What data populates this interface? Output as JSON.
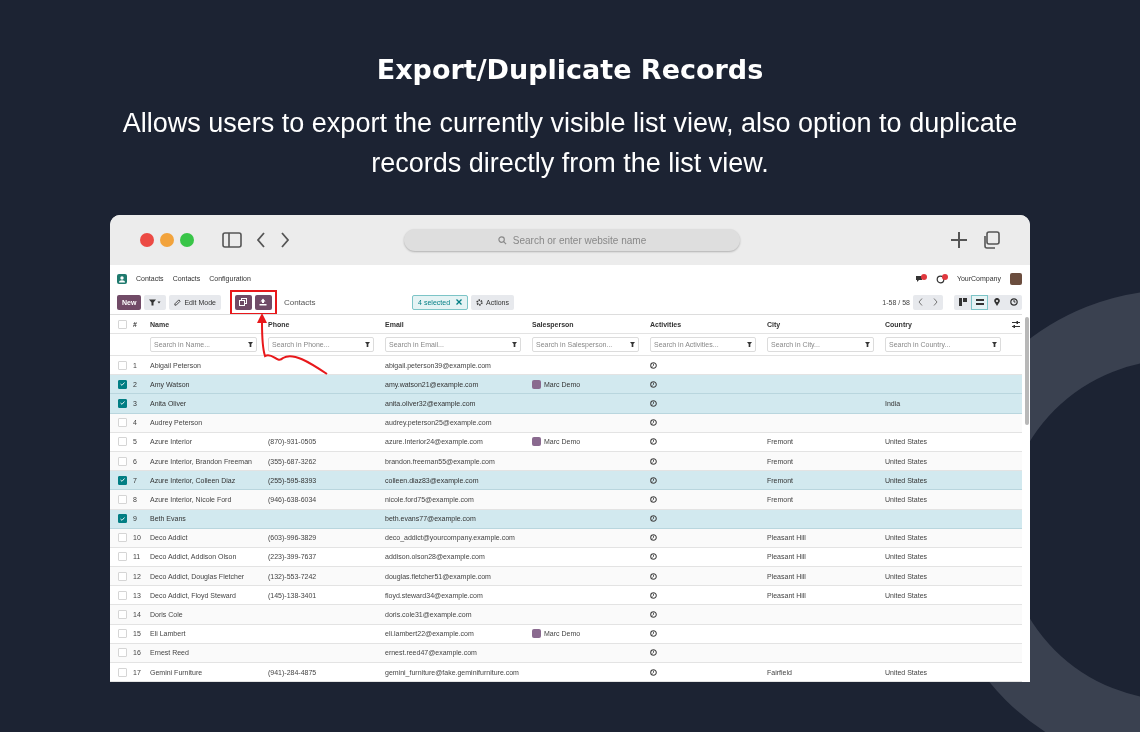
{
  "headline": {
    "title": "Export/Duplicate Records",
    "subtitle": "Allows users to export the currently visible list view, also option to duplicate records directly from the list view."
  },
  "browser": {
    "url_placeholder": "Search or enter website name"
  },
  "app": {
    "brand": "Contacts",
    "menu": [
      "Contacts",
      "Configuration"
    ],
    "company": "YourCompany"
  },
  "toolbar": {
    "new_label": "New",
    "edit_mode": "Edit Mode",
    "breadcrumb": "Contacts",
    "selected_count": "4 selected",
    "actions": "Actions",
    "pager": "1-58 / 58",
    "views": [
      {
        "kind": "kanban",
        "selected": false
      },
      {
        "kind": "list",
        "selected": true
      },
      {
        "kind": "map",
        "selected": false
      },
      {
        "kind": "activity",
        "selected": false
      }
    ]
  },
  "table": {
    "select_all_checked": false,
    "columns": [
      {
        "label": "#"
      },
      {
        "label": "Name",
        "placeholder": "Search in Name..."
      },
      {
        "label": "Phone",
        "placeholder": "Search in Phone..."
      },
      {
        "label": "Email",
        "placeholder": "Search in Email..."
      },
      {
        "label": "Salesperson",
        "placeholder": "Search in Salesperson..."
      },
      {
        "label": "Activities",
        "placeholder": "Search in Activities..."
      },
      {
        "label": "City",
        "placeholder": "Search in City..."
      },
      {
        "label": "Country",
        "placeholder": "Search in Country..."
      }
    ],
    "rows": [
      {
        "num": "1",
        "name": "Abigail Peterson",
        "phone": "",
        "email": "abigail.peterson39@example.com",
        "salesperson": "",
        "city": "",
        "country": "",
        "selected": false
      },
      {
        "num": "2",
        "name": "Amy Watson",
        "phone": "",
        "email": "amy.watson21@example.com",
        "salesperson": "Marc Demo",
        "city": "",
        "country": "",
        "selected": true
      },
      {
        "num": "3",
        "name": "Anita Oliver",
        "phone": "",
        "email": "anita.oliver32@example.com",
        "salesperson": "",
        "city": "",
        "country": "India",
        "selected": true
      },
      {
        "num": "4",
        "name": "Audrey Peterson",
        "phone": "",
        "email": "audrey.peterson25@example.com",
        "salesperson": "",
        "city": "",
        "country": "",
        "selected": false
      },
      {
        "num": "5",
        "name": "Azure Interior",
        "phone": "(870)-931-0505",
        "email": "azure.Interior24@example.com",
        "salesperson": "Marc Demo",
        "city": "Fremont",
        "country": "United States",
        "selected": false
      },
      {
        "num": "6",
        "name": "Azure Interior, Brandon Freeman",
        "phone": "(355)-687-3262",
        "email": "brandon.freeman55@example.com",
        "salesperson": "",
        "city": "Fremont",
        "country": "United States",
        "selected": false
      },
      {
        "num": "7",
        "name": "Azure Interior, Colleen Diaz",
        "phone": "(255)-595-8393",
        "email": "colleen.diaz83@example.com",
        "salesperson": "",
        "city": "Fremont",
        "country": "United States",
        "selected": true
      },
      {
        "num": "8",
        "name": "Azure Interior, Nicole Ford",
        "phone": "(946)-638-6034",
        "email": "nicole.ford75@example.com",
        "salesperson": "",
        "city": "Fremont",
        "country": "United States",
        "selected": false
      },
      {
        "num": "9",
        "name": "Beth Evans",
        "phone": "",
        "email": "beth.evans77@example.com",
        "salesperson": "",
        "city": "",
        "country": "",
        "selected": true
      },
      {
        "num": "10",
        "name": "Deco Addict",
        "phone": "(603)-996-3829",
        "email": "deco_addict@yourcompany.example.com",
        "salesperson": "",
        "city": "Pleasant Hill",
        "country": "United States",
        "selected": false
      },
      {
        "num": "11",
        "name": "Deco Addict, Addison Olson",
        "phone": "(223)-399-7637",
        "email": "addison.olson28@example.com",
        "salesperson": "",
        "city": "Pleasant Hill",
        "country": "United States",
        "selected": false
      },
      {
        "num": "12",
        "name": "Deco Addict, Douglas Fletcher",
        "phone": "(132)-553-7242",
        "email": "douglas.fletcher51@example.com",
        "salesperson": "",
        "city": "Pleasant Hill",
        "country": "United States",
        "selected": false
      },
      {
        "num": "13",
        "name": "Deco Addict, Floyd Steward",
        "phone": "(145)-138-3401",
        "email": "floyd.steward34@example.com",
        "salesperson": "",
        "city": "Pleasant Hill",
        "country": "United States",
        "selected": false
      },
      {
        "num": "14",
        "name": "Doris Cole",
        "phone": "",
        "email": "doris.cole31@example.com",
        "salesperson": "",
        "city": "",
        "country": "",
        "selected": false
      },
      {
        "num": "15",
        "name": "Eli Lambert",
        "phone": "",
        "email": "eli.lambert22@example.com",
        "salesperson": "Marc Demo",
        "city": "",
        "country": "",
        "selected": false
      },
      {
        "num": "16",
        "name": "Ernest Reed",
        "phone": "",
        "email": "ernest.reed47@example.com",
        "salesperson": "",
        "city": "",
        "country": "",
        "selected": false
      },
      {
        "num": "17",
        "name": "Gemini Furniture",
        "phone": "(941)-284-4875",
        "email": "gemini_furniture@fake.geminifurniture.com",
        "salesperson": "",
        "city": "Fairfield",
        "country": "United States",
        "selected": false
      }
    ]
  }
}
